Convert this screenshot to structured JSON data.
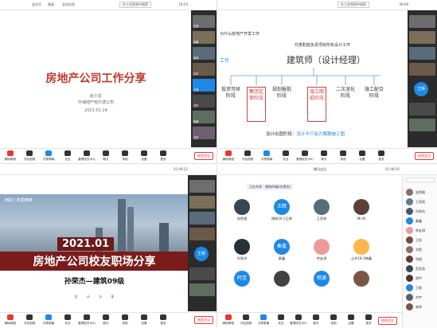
{
  "q1": {
    "topbar": {
      "left_items": [
        "会议号",
        "邀请",
        "会议信息"
      ],
      "search_btn": "在工会视频中搜索",
      "time": "18:54"
    },
    "slide": {
      "title": "房地产公司工作分享",
      "author": "赵小龙",
      "org": "中海地产哈尔滨公司",
      "date": "2021.01.24"
    },
    "side": [
      "王辉",
      "赵鹏",
      "胡帅",
      "孙宇",
      "王辉",
      "刘宇",
      "徐超",
      "王拓"
    ],
    "controls": [
      "解除静音",
      "开启视频",
      "共享屏幕",
      "安全",
      "管理成员(63)",
      "聊天",
      "录制",
      "设置",
      "更多"
    ],
    "end_label": "结束会议"
  },
  "q2": {
    "topbar": {
      "search_btn": "在工会视频中搜索",
      "time": "49:09"
    },
    "slide": {
      "header": "为什么房地产开发工作",
      "sub_left": "工作",
      "note": "代表职能负责项目所有设计工作",
      "main_title": "建筑师（设计经理）",
      "boxes": [
        "投资可研阶段",
        "集团定案阶段",
        "规划报批阶段",
        "施工图纸阶段",
        "二次深化阶段",
        "施工配合阶段"
      ],
      "footer_a": "设计出图阶段：",
      "footer_b": "设计不只有方案跟施工图"
    },
    "side_badge": "王辉",
    "controls": [
      "解除静音",
      "开启视频",
      "共享屏幕",
      "安全",
      "管理成员(63)",
      "聊天",
      "录制",
      "设置",
      "更多"
    ],
    "end_label": "结束会议"
  },
  "q3": {
    "topbar": {
      "time": "01:09:22"
    },
    "slide": {
      "logo": "西财 | 和爱精英",
      "year": "2021.01",
      "title": "房地产公司校友职场分享",
      "speaker": "孙荣杰—建筑09级",
      "footer": [
        "设",
        "计",
        "分",
        "享"
      ]
    },
    "side_badge": "王辉",
    "controls": [
      "解除静音",
      "开启视频",
      "共享屏幕",
      "安全",
      "管理成员(63)",
      "聊天",
      "录制",
      "设置",
      "更多"
    ],
    "end_label": "结束会议"
  },
  "q4": {
    "topbar": {
      "title": "腾讯会议",
      "time": "01:48:50"
    },
    "banner": "正在共享：建筑09级(孙荣杰)",
    "participants": [
      {
        "name": "张然格",
        "avatar_text": ""
      },
      {
        "name": "建筑16-2王辉",
        "avatar_text": "王辉"
      },
      {
        "name": "王亚侠",
        "avatar_text": ""
      },
      {
        "name": "Mr.W",
        "avatar_text": ""
      },
      {
        "name": "孙翠杰",
        "avatar_text": ""
      },
      {
        "name": "秦鑫",
        "avatar_text": "秦鑫"
      },
      {
        "name": "李友琪",
        "avatar_text": ""
      },
      {
        "name": "土木18-2韩鑫",
        "avatar_text": ""
      },
      {
        "name": "阿宝",
        "avatar_text": "阿宝"
      },
      {
        "name": "",
        "avatar_text": ""
      },
      {
        "name": "",
        "avatar_text": "轶源"
      },
      {
        "name": "",
        "avatar_text": ""
      }
    ],
    "chat": [
      "张然格",
      "王亚侠",
      "孙翠杰",
      "秦鑫",
      "李友琪",
      "王拓",
      "刘昊",
      "刘斌",
      "范亚茹",
      "胡宇",
      "王辉",
      "刘宇",
      "林帅"
    ],
    "controls": [
      "解除静音",
      "开启视频",
      "共享屏幕",
      "安全",
      "管理成员(65)",
      "聊天",
      "录制",
      "设置",
      "更多"
    ],
    "end_label": "结束会议"
  },
  "colors": {
    "red": "#c0392b",
    "blue": "#1e88e5",
    "dark": "#2b2b2b"
  }
}
